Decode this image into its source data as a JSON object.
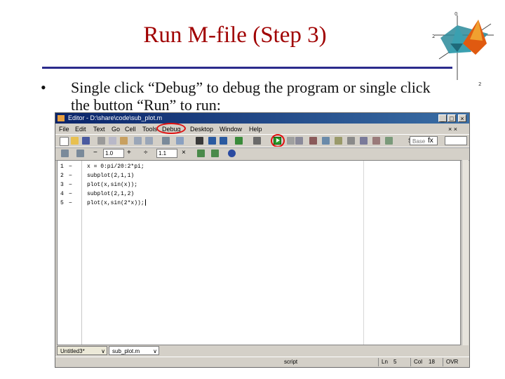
{
  "slide": {
    "title": "Run M-file (Step 3)",
    "bullet_marker": "•",
    "bullet_text": "Single click “Debug” to debug the program or single click the button “Run” to run:"
  },
  "window": {
    "title": "Editor - D:\\share\\code\\sub_plot.m",
    "buttons": {
      "minimize": "_",
      "maximize": "□",
      "close": "×"
    },
    "menus": [
      "File",
      "Edit",
      "Text",
      "Go",
      "Cell",
      "Tools",
      "Debug",
      "Desktop",
      "Window",
      "Help"
    ],
    "menu_close": "× ×"
  },
  "toolbar": {
    "stack_label": "Stack:",
    "stack_value": "Base",
    "fx_label": "fx",
    "cell_value_1": "1.0",
    "cell_value_2": "1.1",
    "minus": "−",
    "plus": "+",
    "divide": "÷",
    "times": "×"
  },
  "editor": {
    "lines": [
      {
        "number": "1",
        "marker": "−",
        "code": "x = 0:pi/20:2*pi;"
      },
      {
        "number": "2",
        "marker": "−",
        "code": "subplot(2,1,1)"
      },
      {
        "number": "3",
        "marker": "−",
        "code": "plot(x,sin(x));"
      },
      {
        "number": "4",
        "marker": "−",
        "code": "subplot(2,1,2)"
      },
      {
        "number": "5",
        "marker": "−",
        "code": "plot(x,sin(2*x));"
      }
    ]
  },
  "tabs": [
    {
      "label": "Untitled3*",
      "arrow": "∨"
    },
    {
      "label": "sub_plot.m",
      "arrow": "∨"
    }
  ],
  "status": {
    "mode": "script",
    "ln_label": "Ln",
    "ln_value": "5",
    "col_label": "Col",
    "col_value": "18",
    "ovr": "OVR"
  },
  "colors": {
    "title": "#a00000",
    "rule": "#2b2b8c",
    "highlight_ring": "#e01010",
    "run_button": "#2c9a2c"
  },
  "icons": [
    "matlab-logo",
    "new-file-icon",
    "open-folder-icon",
    "save-icon",
    "cut-icon",
    "copy-icon",
    "paste-icon",
    "undo-icon",
    "redo-icon",
    "print-icon",
    "find-icon",
    "back-icon",
    "forward-icon",
    "function-icon",
    "run-icon",
    "breakpoint-icon",
    "step-icon",
    "help-icon"
  ]
}
